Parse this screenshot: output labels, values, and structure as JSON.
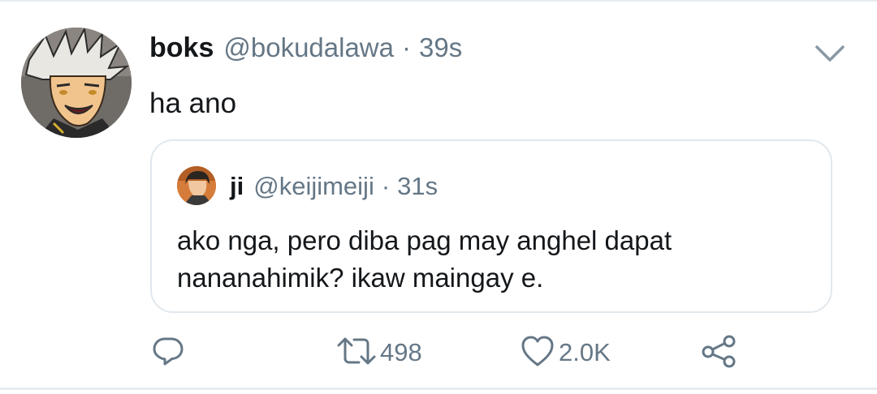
{
  "tweet": {
    "display_name": "boks",
    "handle": "@bokudalawa",
    "separator": "·",
    "time": "39s",
    "text": "ha ano"
  },
  "quoted_tweet": {
    "display_name": "ji",
    "handle": "@keijimeiji",
    "separator": "·",
    "time": "31s",
    "text": "ako nga, pero diba pag may anghel dapat nananahimik? ikaw maingay e."
  },
  "actions": {
    "reply_icon": "reply-icon",
    "retweet_icon": "retweet-icon",
    "retweet_count": "498",
    "like_icon": "heart-icon",
    "like_count": "2.0K",
    "share_icon": "share-icon"
  },
  "colors": {
    "text": "#14171a",
    "secondary": "#657786",
    "border": "#e1e8ed"
  }
}
